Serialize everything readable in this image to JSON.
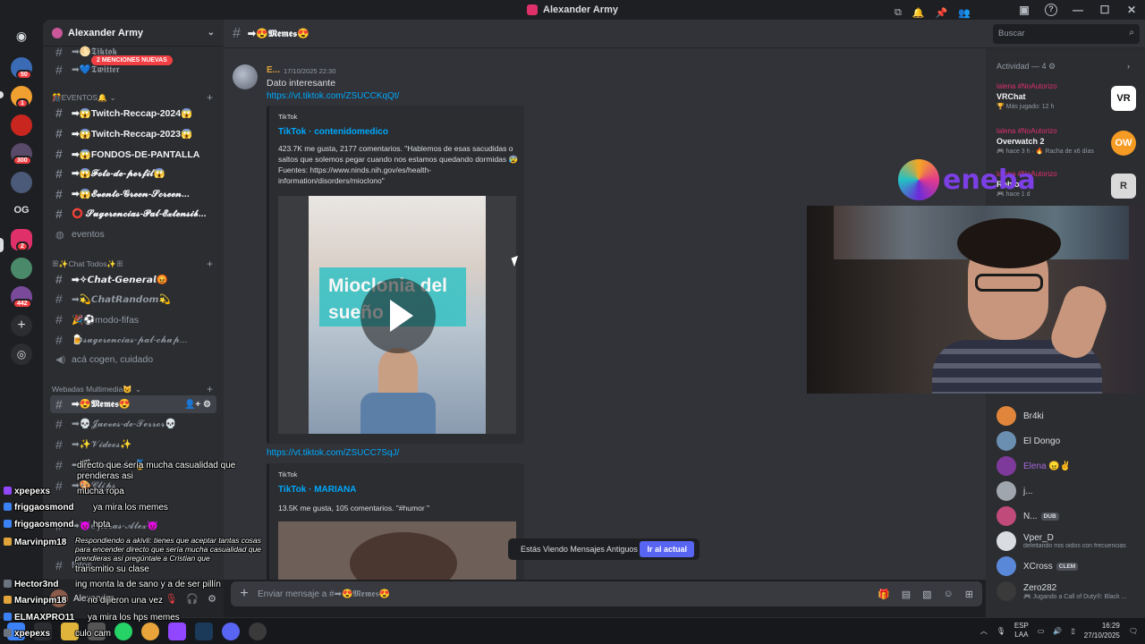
{
  "window": {
    "title": "Alexander Army"
  },
  "server": {
    "name": "Alexander Army",
    "mention_banner": "2 MENCIONES NUEVAS",
    "rail_badges": [
      "50",
      "1",
      "300",
      "2",
      "442"
    ],
    "rail_text": "OG"
  },
  "channels": {
    "top_partial": [
      "➡🌕𝕿𝖎𝖐𝖙𝖔𝖐",
      "➡💙𝕿𝖜𝖎𝖙𝖙𝖊𝖗"
    ],
    "cat_eventos": "🎊EVENTOS🔔",
    "eventos": [
      "➡😱Twitch-Reccap-2024😱",
      "➡😱Twitch-Reccap-2023😱",
      "➡😱FONDOS-DE-PANTALLA",
      "➡😱𝓕𝓸𝓽𝓸-𝓭𝓮-𝓹𝓮𝓻𝓯𝓲𝓵😱",
      "➡😱𝓔𝓿𝓮𝓷𝓽𝓸-𝓖𝓻𝓮𝓮𝓷-𝓢𝓬𝓻𝓮𝓮𝓷...",
      "⭕ 𝓢𝓾𝓰𝓮𝓻𝓮𝓷𝓬𝓲𝓪𝓼-𝓟𝓪𝓵-𝓔𝔁𝓽𝓮𝓷𝓼𝓲𝓫...",
      "eventos"
    ],
    "cat_chat": "ꕥ✨Chat Todos✨ꕥ",
    "chat": [
      "➡✧𝘾𝙝𝙖𝙩-𝙂𝙚𝙣𝙚𝙧𝙖𝙡😡",
      "➡💫𝘾𝙝𝙖𝙩𝙍𝙖𝙣𝙙𝙤𝙢💫",
      "🎉⚽modo-fifas",
      "🍺𝓼𝓾𝓰𝓮𝓻𝓮𝓷𝓬𝓲𝓪𝓼-𝓹𝓪𝓵-𝓬𝓱𝓾𝓹...",
      "acá cogen, cuidado"
    ],
    "cat_multi": "Webadas Multimedia😺",
    "multi": [
      "➡😍𝕸𝖊𝖒𝖊𝖘😍",
      "➡💀𝓙𝓾𝓮𝓿𝓮𝓼-𝓭𝓮-𝓣𝓮𝓻𝓻𝓸𝓻💀",
      "➡✨𝓥𝓲𝓭𝓮𝓸𝓼✨",
      "➡🎬𝓐𝓾𝓽𝓸𝓻𝓸𝓵𝓮𝓼🥇",
      "➡🎨𝓒𝓵𝓲𝓹𝓼",
      "➡😈𝓞𝓹𝓮𝓻𝓪𝓼-𝓐𝓵𝓮𝔁😈",
      "fotos"
    ]
  },
  "header": {
    "channel": "➡😍𝕸𝖊𝖒𝖊𝖘😍",
    "search_placeholder": "Buscar"
  },
  "message": {
    "author": "E...",
    "timestamp": "17/10/2025 22:30",
    "text": "Dato interesante",
    "link1": "https://vt.tiktok.com/ZSUCCKqQt/",
    "embed1": {
      "provider": "TikTok",
      "title": "TikTok · contenidomedico",
      "description": "423.7K me gusta, 2177 comentarios. \"Hablemos de esas sacudidas o saltos que solemos pegar cuando nos estamos quedando dormidas 😰 Fuentes: https://www.ninds.nih.gov/es/health-information/disorders/mioclono\"",
      "overlay": "Mioclonia del sueño"
    },
    "link2": "https://vt.tiktok.com/ZSUCC7SqJ/",
    "embed2": {
      "provider": "TikTok",
      "title": "TikTok · MARIANA",
      "description": "13.5K me gusta, 105 comentarios. \"#humor \""
    }
  },
  "toast": {
    "text": "Estás Viendo Mensajes Antiguos",
    "button": "Ir al actual"
  },
  "composer": {
    "placeholder": "Enviar mensaje a #➡😍𝕸𝖊𝖒𝖊𝖘😍"
  },
  "activity": {
    "header": "Actividad — 4",
    "items": [
      {
        "user": "lalena #NoAutorizo",
        "game": "VRChat",
        "meta": "🏆 Más jugado: 12 h",
        "icon": "VR"
      },
      {
        "user": "lalena #NoAutorizo",
        "game": "Overwatch 2",
        "meta": "🎮 hace 3 h · 🔥 Racha de x6 días",
        "icon": "OW"
      },
      {
        "user": "lalena #NoAutorizo",
        "game": "Roblox",
        "meta": "🎮 hace 1 d",
        "icon": "R"
      }
    ]
  },
  "members": [
    {
      "name": "Br4ki",
      "sub": "",
      "tag": "",
      "color": "#e0853a"
    },
    {
      "name": "El Dongo",
      "sub": "",
      "tag": "",
      "color": "#6a8fb0"
    },
    {
      "name": "Elena 😠✌",
      "sub": "",
      "tag": "",
      "color": "#7e3a9a"
    },
    {
      "name": "j...",
      "sub": "",
      "tag": "",
      "color": "#a0a6ad"
    },
    {
      "name": "N...",
      "sub": "",
      "tag": "DUB",
      "color": "#c04a7a"
    },
    {
      "name": "Vper_D",
      "sub": "deleitando mis oidos con frecuencias",
      "tag": "",
      "color": "#d9dde2"
    },
    {
      "name": "XCross",
      "sub": "",
      "tag": "CLEM",
      "color": "#5a88d9"
    },
    {
      "name": "Zero282",
      "sub": "🎮 Jugando a Call of Duty®: Black ...",
      "tag": "",
      "color": "#3a3a3a"
    }
  ],
  "userbar": {
    "name": "Alexander_"
  },
  "stream_chat": [
    {
      "user": "",
      "text": "directo que sería mucha casualidad que"
    },
    {
      "user": "",
      "text": "prendieras asi"
    },
    {
      "user": "xpepexs",
      "text": "mucha ropa"
    },
    {
      "user": "friggaosmond",
      "text": "ya mira los memes"
    },
    {
      "user": "friggaosmond",
      "text": "hpta"
    },
    {
      "user": "Marvinpm18",
      "text": "Respondiendo a akivli: tienes que aceptar tantas cosas para encender directo que sería mucha casualidad que prendieras asi  pregúntale a Cristian que"
    },
    {
      "user": "",
      "text": "transmitio su clase"
    },
    {
      "user": "Hector3nd",
      "text": "ing monta la de sano y a de ser pillín"
    },
    {
      "user": "Marvinpm18",
      "text": "no dijieron una vez"
    },
    {
      "user": "ELMAXPRO11",
      "text": "ya mira los hps memes"
    },
    {
      "user": "xpepexs",
      "text": "culo cam"
    }
  ],
  "taskbar": {
    "lang1": "ESP",
    "lang2": "LAA",
    "time": "16:29",
    "date": "27/10/2025"
  },
  "colors": {
    "accent": "#5865f2",
    "link": "#00a8fc",
    "mention": "#f23f43",
    "bg": "#313338"
  }
}
